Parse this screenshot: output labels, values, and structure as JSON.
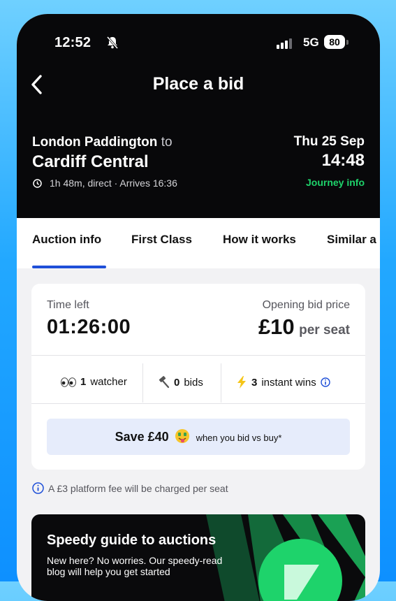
{
  "status": {
    "time": "12:52",
    "network": "5G",
    "battery": "80"
  },
  "header": {
    "title": "Place a bid"
  },
  "journey": {
    "origin": "London Paddington",
    "to_word": "to",
    "destination": "Cardiff Central",
    "details": "1h 48m, direct · Arrives 16:36",
    "date": "Thu 25 Sep",
    "departure_time": "14:48",
    "info_link": "Journey info"
  },
  "tabs": [
    "Auction info",
    "First Class",
    "How it works",
    "Similar a"
  ],
  "auction": {
    "time_left_label": "Time left",
    "time_left": "01:26:00",
    "opening_label": "Opening bid price",
    "opening_price": "£10",
    "per_seat": "per seat",
    "watchers_count": "1",
    "watchers_label": "watcher",
    "bids_count": "0",
    "bids_label": "bids",
    "instant_count": "3",
    "instant_label": "instant wins",
    "save_big": "Save £40",
    "save_small": "when you bid vs buy*"
  },
  "fee_notice": "A £3 platform fee will be charged per seat",
  "guide": {
    "title": "Speedy guide to auctions",
    "text": "New here? No worries. Our speedy-read blog will help you get started"
  },
  "colors": {
    "accent_blue": "#1e4fd8",
    "journey_green": "#1ed36b",
    "save_bg": "#e6ecfb",
    "bolt": "#f5c518"
  }
}
